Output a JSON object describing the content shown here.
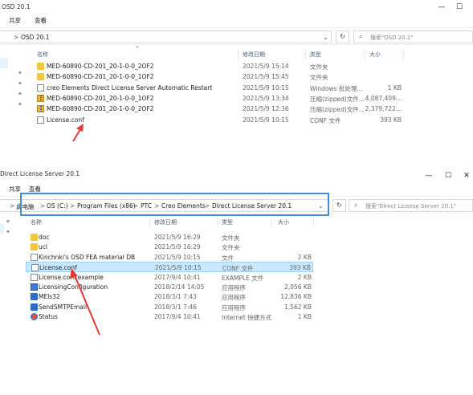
{
  "win1": {
    "title": "OSD 20.1",
    "tabs": [
      "共享",
      "查看"
    ],
    "address": {
      "parts": [
        "OSD 20.1"
      ],
      "sep": ">"
    },
    "search_placeholder": "搜索\"OSD 20.1\"",
    "columns": {
      "name": "名称",
      "date": "修改日期",
      "type": "类型",
      "size": "大小"
    },
    "files": [
      {
        "name": "MED-60890-CD-201_20-1-0-0_2OF2",
        "date": "2021/5/9 15:14",
        "type": "文件夹",
        "size": "",
        "icon": "folder-icon"
      },
      {
        "name": "MED-60890-CD-201_20-1-0-0_1OF2",
        "date": "2021/5/9 15:45",
        "type": "文件夹",
        "size": "",
        "icon": "folder-icon"
      },
      {
        "name": "creo Elements Direct License Server Automatic Restart",
        "date": "2021/5/9 10:15",
        "type": "Windows 批处理...",
        "size": "1 KB",
        "icon": "batch-file-icon"
      },
      {
        "name": "MED-60890-CD-201_20-1-0-0_1OF2",
        "date": "2021/5/9 13:34",
        "type": "压缩(zipped)文件...",
        "size": "4,087,409...",
        "icon": "zip-icon"
      },
      {
        "name": "MED-60890-CD-201_20-1-0-0_2OF2",
        "date": "2021/5/9 12:36",
        "type": "压缩(zipped)文件...",
        "size": "2,379,722...",
        "icon": "zip-icon"
      },
      {
        "name": "License.conf",
        "date": "2021/5/9 10:15",
        "type": "CONF 文件",
        "size": "393 KB",
        "icon": "document-icon"
      }
    ]
  },
  "win2": {
    "title": "Direct License Server 20.1",
    "tabs": [
      "共享",
      "查看"
    ],
    "address": {
      "parts": [
        "此电脑",
        "OS (C:)",
        "Program Files (x86)",
        "PTC",
        "Creo Elements",
        "Direct License Server 20.1"
      ],
      "sep": ">"
    },
    "search_placeholder": "搜索\"Direct License Server 20.1\"",
    "columns": {
      "name": "名称",
      "date": "修改日期",
      "type": "类型",
      "size": "大小"
    },
    "files": [
      {
        "name": "doc",
        "date": "2021/5/9 16:29",
        "type": "文件夹",
        "size": "",
        "icon": "folder-icon"
      },
      {
        "name": "ucl",
        "date": "2021/5/9 16:29",
        "type": "文件夹",
        "size": "",
        "icon": "folder-icon"
      },
      {
        "name": "Kinchnki's OSD FEA material DB",
        "date": "2021/5/9 10:15",
        "type": "文件",
        "size": "2 KB",
        "icon": "document-icon"
      },
      {
        "name": "License.conf",
        "date": "2021/5/9 10:15",
        "type": "CONF 文件",
        "size": "393 KB",
        "icon": "document-icon",
        "selected": true
      },
      {
        "name": "License.conf.example",
        "date": "2017/9/4 10:41",
        "type": "EXAMPLE 文件",
        "size": "2 KB",
        "icon": "document-icon"
      },
      {
        "name": "LicensingConfiguration",
        "date": "2018/2/14 14:05",
        "type": "应用程序",
        "size": "2,056 KB",
        "icon": "app-icon"
      },
      {
        "name": "MEls32",
        "date": "2018/3/1 7:43",
        "type": "应用程序",
        "size": "12,836 KB",
        "icon": "exe-icon"
      },
      {
        "name": "SendSMTPEmail",
        "date": "2018/3/1 7:46",
        "type": "应用程序",
        "size": "1,562 KB",
        "icon": "exe-icon"
      },
      {
        "name": "Status",
        "date": "2017/9/4 10:41",
        "type": "Internet 快捷方式",
        "size": "1 KB",
        "icon": "status-icon"
      }
    ]
  },
  "colors": {
    "selection": "#cce8ff",
    "selection_border": "#99d1ff",
    "annotation_box": "#3c8fd8",
    "arrow": "#e53935",
    "folder": "#f3c63d"
  }
}
